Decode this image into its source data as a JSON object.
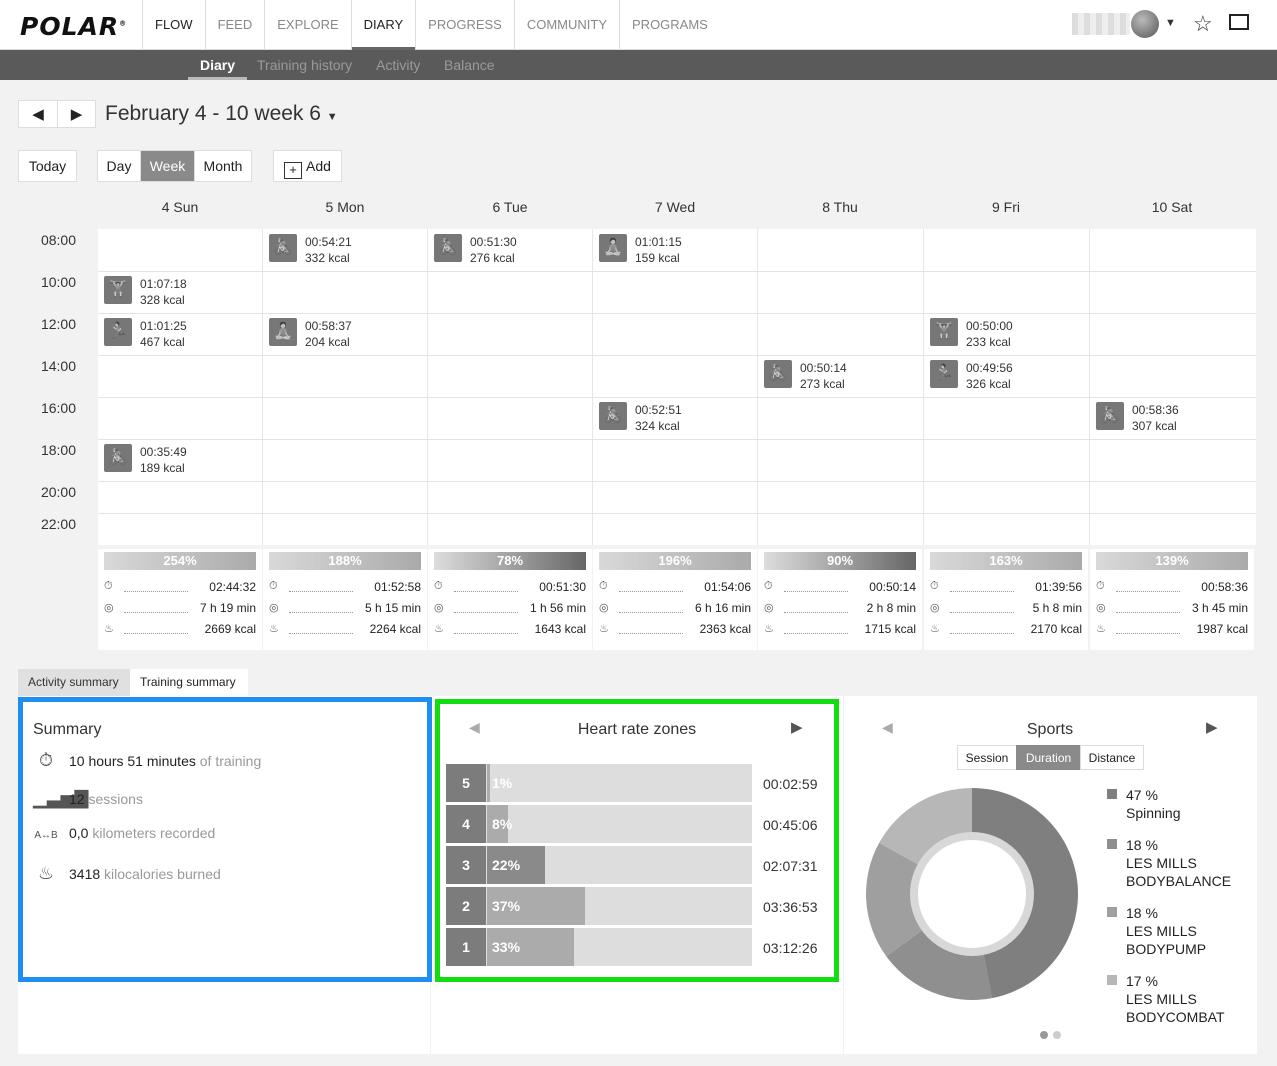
{
  "brand": "POLAR",
  "nav": [
    "FLOW",
    "FEED",
    "EXPLORE",
    "DIARY",
    "PROGRESS",
    "COMMUNITY",
    "PROGRAMS"
  ],
  "subnav": [
    "Diary",
    "Training history",
    "Activity",
    "Balance"
  ],
  "date_title": "February 4 - 10 week 6",
  "view_buttons": {
    "today": "Today",
    "day": "Day",
    "week": "Week",
    "month": "Month",
    "add": "Add"
  },
  "days": [
    "4 Sun",
    "5 Mon",
    "6 Tue",
    "7 Wed",
    "8 Thu",
    "9 Fri",
    "10 Sat"
  ],
  "times": [
    "08:00",
    "10:00",
    "12:00",
    "14:00",
    "16:00",
    "18:00",
    "20:00",
    "22:00"
  ],
  "sessions": [
    {
      "day": 0,
      "slot": 1,
      "icon": "bodypump-icon",
      "duration": "01:07:18",
      "kcal": "328 kcal"
    },
    {
      "day": 0,
      "slot": 2,
      "icon": "bodycombat-icon",
      "duration": "01:01:25",
      "kcal": "467 kcal"
    },
    {
      "day": 0,
      "slot": 5,
      "icon": "spinning-icon",
      "duration": "00:35:49",
      "kcal": "189 kcal"
    },
    {
      "day": 1,
      "slot": 0,
      "icon": "spinning-icon",
      "duration": "00:54:21",
      "kcal": "332 kcal"
    },
    {
      "day": 1,
      "slot": 2,
      "icon": "bodybalance-icon",
      "duration": "00:58:37",
      "kcal": "204 kcal"
    },
    {
      "day": 2,
      "slot": 0,
      "icon": "spinning-icon",
      "duration": "00:51:30",
      "kcal": "276 kcal"
    },
    {
      "day": 3,
      "slot": 0,
      "icon": "bodybalance-icon",
      "duration": "01:01:15",
      "kcal": "159 kcal"
    },
    {
      "day": 3,
      "slot": 4,
      "icon": "spinning-icon",
      "duration": "00:52:51",
      "kcal": "324 kcal"
    },
    {
      "day": 4,
      "slot": 3,
      "icon": "spinning-icon",
      "duration": "00:50:14",
      "kcal": "273 kcal"
    },
    {
      "day": 5,
      "slot": 2,
      "icon": "bodypump-icon",
      "duration": "00:50:00",
      "kcal": "233 kcal"
    },
    {
      "day": 5,
      "slot": 3,
      "icon": "bodycombat-icon",
      "duration": "00:49:56",
      "kcal": "326 kcal"
    },
    {
      "day": 6,
      "slot": 4,
      "icon": "spinning-icon",
      "duration": "00:58:36",
      "kcal": "307 kcal"
    }
  ],
  "day_summaries": [
    {
      "pct": "254%",
      "training": "02:44:32",
      "active": "7 h 19 min",
      "kcal": "2669 kcal"
    },
    {
      "pct": "188%",
      "training": "01:52:58",
      "active": "5 h 15 min",
      "kcal": "2264 kcal"
    },
    {
      "pct": "78%",
      "training": "00:51:30",
      "active": "1 h 56 min",
      "kcal": "1643 kcal"
    },
    {
      "pct": "196%",
      "training": "01:54:06",
      "active": "6 h 16 min",
      "kcal": "2363 kcal"
    },
    {
      "pct": "90%",
      "training": "00:50:14",
      "active": "2 h 8 min",
      "kcal": "1715 kcal"
    },
    {
      "pct": "163%",
      "training": "01:39:56",
      "active": "5 h 8 min",
      "kcal": "2170 kcal"
    },
    {
      "pct": "139%",
      "training": "00:58:36",
      "active": "3 h 45 min",
      "kcal": "1987 kcal"
    }
  ],
  "summary_tabs": [
    "Activity summary",
    "Training summary"
  ],
  "summary": {
    "title": "Summary",
    "training_value": "10 hours 51 minutes",
    "training_suffix": "of training",
    "sessions_value": "12",
    "sessions_suffix": "sessions",
    "distance_value": "0,0",
    "distance_suffix": "kilometers recorded",
    "kcal_value": "3418",
    "kcal_suffix": "kilocalories burned"
  },
  "heart_rate": {
    "title": "Heart rate zones",
    "zones": [
      {
        "zone": "5",
        "pct": "1%",
        "fraction": 0.01,
        "time": "00:02:59"
      },
      {
        "zone": "4",
        "pct": "8%",
        "fraction": 0.08,
        "time": "00:45:06"
      },
      {
        "zone": "3",
        "pct": "22%",
        "fraction": 0.22,
        "time": "02:07:31"
      },
      {
        "zone": "2",
        "pct": "37%",
        "fraction": 0.37,
        "time": "03:36:53"
      },
      {
        "zone": "1",
        "pct": "33%",
        "fraction": 0.33,
        "time": "03:12:26"
      }
    ]
  },
  "sports": {
    "title": "Sports",
    "tabs": [
      "Session",
      "Duration",
      "Distance"
    ],
    "selected_tab": "Duration",
    "items": [
      {
        "pct": "47 %",
        "name": "Spinning",
        "fraction": 0.47,
        "color": "#7f7f7f"
      },
      {
        "pct": "18 %",
        "name": "LES MILLS BODYBALANCE",
        "fraction": 0.18,
        "color": "#8f8f8f"
      },
      {
        "pct": "18 %",
        "name": "LES MILLS BODYPUMP",
        "fraction": 0.18,
        "color": "#9f9f9f"
      },
      {
        "pct": "17 %",
        "name": "LES MILLS BODYCOMBAT",
        "fraction": 0.17,
        "color": "#b7b7b7"
      }
    ]
  },
  "colors": {
    "highlight_blue": "#1e8ff0",
    "highlight_green": "#11dd11",
    "subnav_bg": "#5a5a5a"
  }
}
